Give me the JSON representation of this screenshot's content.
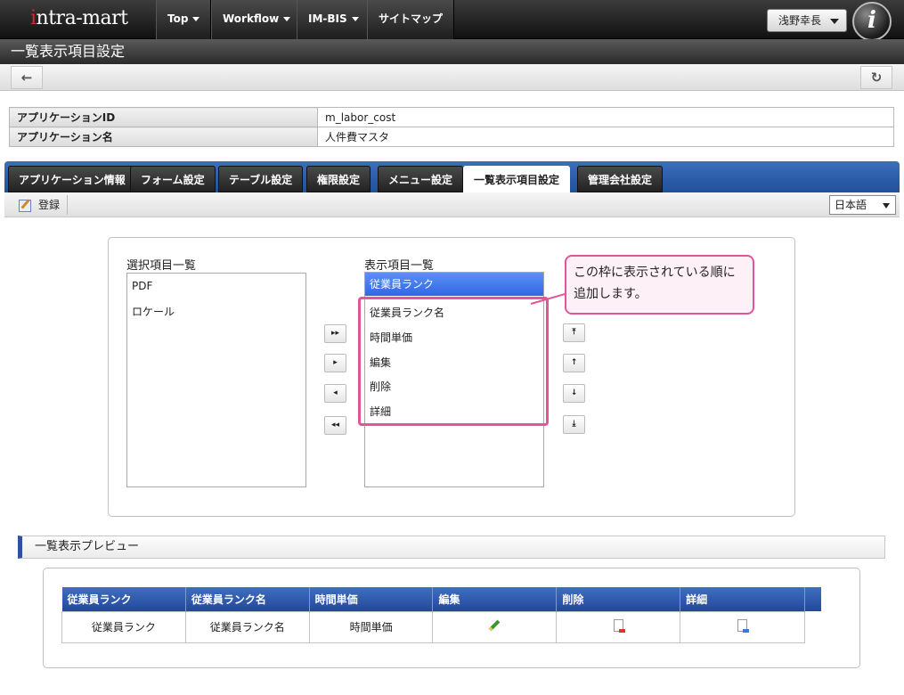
{
  "header": {
    "logo": "intra-mart",
    "nav": [
      {
        "label": "Top",
        "dropdown": true
      },
      {
        "label": "Workflow",
        "dropdown": true
      },
      {
        "label": "IM-BIS",
        "dropdown": true
      },
      {
        "label": "サイトマップ",
        "dropdown": false
      }
    ],
    "user": "浅野幸長",
    "badge": "i"
  },
  "page_title": "一覧表示項目設定",
  "toolbar": {
    "back_icon": "←",
    "refresh_icon": "↻"
  },
  "info": {
    "app_id_label": "アプリケーションID",
    "app_id_value": "m_labor_cost",
    "app_name_label": "アプリケーション名",
    "app_name_value": "人件費マスタ"
  },
  "tabs": [
    {
      "label": "アプリケーション情報",
      "active": false
    },
    {
      "label": "フォーム設定",
      "active": false
    },
    {
      "label": "テーブル設定",
      "active": false
    },
    {
      "label": "権限設定",
      "active": false
    },
    {
      "label": "メニュー設定",
      "active": false
    },
    {
      "label": "一覧表示項目設定",
      "active": true
    },
    {
      "label": "管理会社設定",
      "active": false
    }
  ],
  "subtoolbar": {
    "register_label": "登録",
    "language": "日本語"
  },
  "selector": {
    "available_label": "選択項目一覧",
    "available_items": [
      "PDF",
      "ロケール"
    ],
    "displayed_label": "表示項目一覧",
    "displayed_items": [
      "従業員ランク",
      "従業員ランク名",
      "時間単価",
      "編集",
      "削除",
      "詳細"
    ],
    "selected_item": "従業員ランク",
    "move_buttons": [
      "▸▸",
      "▸",
      "◂",
      "◂◂"
    ],
    "order_buttons": [
      "⤒",
      "↑",
      "↓",
      "⤓"
    ]
  },
  "callout": "この枠に表示されている順に追加します。",
  "preview": {
    "title": "一覧表示プレビュー",
    "columns": [
      "従業員ランク",
      "従業員ランク名",
      "時間単価",
      "編集",
      "削除",
      "詳細"
    ],
    "row": [
      "従業員ランク",
      "従業員ランク名",
      "時間単価"
    ]
  },
  "colors": {
    "accent_blue": "#2d52a0",
    "callout_pink": "#e0569b",
    "selection_blue": "#3068e4"
  }
}
